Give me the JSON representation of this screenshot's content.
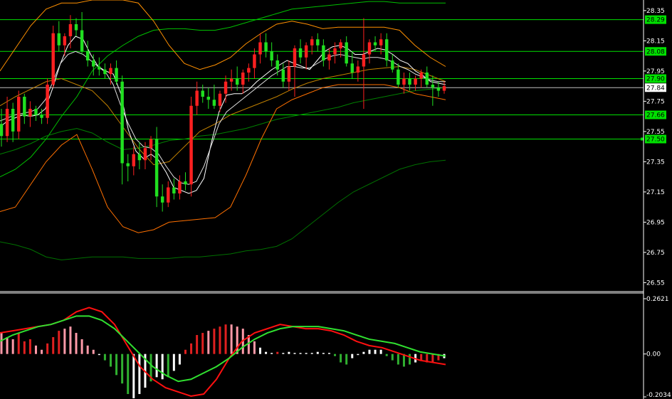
{
  "chart_data": [
    {
      "type": "candlestick",
      "panel": "price",
      "ylim": [
        26.5,
        28.42
      ],
      "y_ticks": [
        "28.35",
        "28.15",
        "27.95",
        "27.75",
        "27.55",
        "27.35",
        "27.15",
        "26.95",
        "26.75",
        "26.55"
      ],
      "y_tick_values": [
        28.35,
        28.15,
        27.95,
        27.75,
        27.55,
        27.35,
        27.15,
        26.95,
        26.75,
        26.55
      ],
      "candles": [
        [
          27.6,
          27.7,
          27.45,
          27.52
        ],
        [
          27.52,
          27.78,
          27.48,
          27.7
        ],
        [
          27.7,
          27.74,
          27.48,
          27.55
        ],
        [
          27.55,
          27.82,
          27.5,
          27.78
        ],
        [
          27.78,
          27.8,
          27.6,
          27.65
        ],
        [
          27.65,
          27.75,
          27.58,
          27.7
        ],
        [
          27.7,
          27.72,
          27.62,
          27.66
        ],
        [
          27.66,
          27.7,
          27.6,
          27.64
        ],
        [
          27.64,
          27.9,
          27.6,
          27.86
        ],
        [
          27.86,
          28.25,
          27.84,
          28.2
        ],
        [
          28.2,
          28.28,
          28.08,
          28.12
        ],
        [
          28.12,
          28.2,
          28.05,
          28.18
        ],
        [
          28.18,
          28.32,
          28.1,
          28.26
        ],
        [
          28.26,
          28.3,
          28.18,
          28.22
        ],
        [
          28.22,
          28.34,
          28.06,
          28.08
        ],
        [
          28.08,
          28.15,
          27.98,
          28.02
        ],
        [
          28.02,
          28.06,
          27.92,
          27.98
        ],
        [
          27.98,
          28.04,
          27.92,
          27.96
        ],
        [
          27.96,
          28.0,
          27.9,
          27.93
        ],
        [
          27.93,
          28.0,
          27.86,
          27.97
        ],
        [
          27.97,
          28.02,
          27.86,
          27.88
        ],
        [
          27.88,
          27.92,
          27.2,
          27.34
        ],
        [
          27.34,
          27.4,
          27.22,
          27.32
        ],
        [
          27.32,
          27.45,
          27.26,
          27.4
        ],
        [
          27.4,
          27.48,
          27.3,
          27.36
        ],
        [
          27.36,
          27.48,
          27.3,
          27.44
        ],
        [
          27.44,
          27.52,
          27.36,
          27.5
        ],
        [
          27.5,
          27.58,
          27.05,
          27.12
        ],
        [
          27.12,
          27.2,
          27.02,
          27.08
        ],
        [
          27.08,
          27.22,
          27.05,
          27.18
        ],
        [
          27.18,
          27.24,
          27.1,
          27.14
        ],
        [
          27.14,
          27.26,
          27.1,
          27.22
        ],
        [
          27.22,
          27.28,
          27.16,
          27.2
        ],
        [
          27.2,
          27.78,
          27.12,
          27.72
        ],
        [
          27.72,
          27.88,
          27.66,
          27.82
        ],
        [
          27.82,
          27.86,
          27.74,
          27.78
        ],
        [
          27.78,
          27.84,
          27.7,
          27.76
        ],
        [
          27.76,
          27.86,
          27.7,
          27.72
        ],
        [
          27.72,
          27.82,
          27.68,
          27.8
        ],
        [
          27.8,
          27.92,
          27.74,
          27.88
        ],
        [
          27.88,
          27.96,
          27.82,
          27.9
        ],
        [
          27.9,
          27.98,
          27.82,
          27.86
        ],
        [
          27.86,
          27.96,
          27.8,
          27.94
        ],
        [
          27.94,
          28.0,
          27.88,
          27.97
        ],
        [
          27.97,
          28.1,
          27.9,
          28.06
        ],
        [
          28.06,
          28.2,
          28.0,
          28.14
        ],
        [
          28.14,
          28.2,
          28.04,
          28.08
        ],
        [
          28.08,
          28.14,
          27.98,
          28.02
        ],
        [
          28.02,
          28.06,
          27.92,
          27.96
        ],
        [
          27.96,
          28.0,
          27.84,
          27.88
        ],
        [
          27.88,
          28.02,
          27.82,
          27.98
        ],
        [
          27.98,
          28.12,
          27.78,
          28.1
        ],
        [
          28.1,
          28.16,
          28.0,
          28.04
        ],
        [
          28.04,
          28.14,
          27.96,
          28.12
        ],
        [
          28.12,
          28.18,
          28.06,
          28.16
        ],
        [
          28.16,
          28.2,
          28.08,
          28.12
        ],
        [
          28.12,
          28.16,
          27.98,
          28.02
        ],
        [
          28.02,
          28.1,
          27.96,
          28.06
        ],
        [
          28.06,
          28.14,
          28.0,
          28.1
        ],
        [
          28.1,
          28.16,
          28.04,
          28.14
        ],
        [
          28.14,
          28.18,
          27.98,
          28.0
        ],
        [
          28.0,
          28.08,
          27.9,
          27.94
        ],
        [
          27.94,
          28.02,
          27.88,
          27.98
        ],
        [
          27.98,
          28.3,
          27.7,
          28.06
        ],
        [
          28.06,
          28.16,
          28.0,
          28.14
        ],
        [
          28.14,
          28.18,
          28.08,
          28.12
        ],
        [
          28.12,
          28.2,
          28.06,
          28.16
        ],
        [
          28.16,
          28.2,
          27.98,
          28.02
        ],
        [
          28.02,
          28.06,
          27.94,
          27.96
        ],
        [
          27.96,
          28.0,
          27.84,
          27.86
        ],
        [
          27.86,
          27.94,
          27.8,
          27.9
        ],
        [
          27.9,
          27.94,
          27.82,
          27.86
        ],
        [
          27.86,
          27.92,
          27.82,
          27.9
        ],
        [
          27.9,
          27.96,
          27.84,
          27.94
        ],
        [
          27.94,
          27.98,
          27.84,
          27.86
        ],
        [
          27.86,
          27.92,
          27.72,
          27.84
        ],
        [
          27.84,
          27.88,
          27.78,
          27.82
        ],
        [
          27.82,
          27.88,
          27.8,
          27.85
        ]
      ],
      "bands": [
        {
          "color": "#00c000",
          "values": [
            27.25,
            27.3,
            27.38,
            27.5,
            27.65,
            27.78,
            27.95,
            28.05,
            28.12,
            28.18,
            28.22,
            28.23,
            28.23,
            28.22,
            28.22,
            28.24,
            28.27,
            28.3,
            28.33,
            28.36,
            28.37,
            28.38,
            28.39,
            28.4,
            28.41,
            28.41,
            28.4,
            28.4,
            28.4,
            28.4
          ]
        },
        {
          "color": "#008000",
          "values": [
            27.4,
            27.43,
            27.47,
            27.52,
            27.55,
            27.57,
            27.54,
            27.48,
            27.43,
            27.44,
            27.46,
            27.49,
            27.5,
            27.52,
            27.53,
            27.55,
            27.57,
            27.6,
            27.63,
            27.65,
            27.67,
            27.69,
            27.71,
            27.74,
            27.76,
            27.78,
            27.8,
            27.82,
            27.83,
            27.84
          ]
        },
        {
          "color": "#007000",
          "values": [
            26.82,
            26.8,
            26.77,
            26.72,
            26.7,
            26.71,
            26.72,
            26.72,
            26.72,
            26.71,
            26.71,
            26.71,
            26.72,
            26.72,
            26.73,
            26.74,
            26.76,
            26.77,
            26.79,
            26.84,
            26.92,
            27.0,
            27.08,
            27.15,
            27.2,
            27.25,
            27.3,
            27.33,
            27.35,
            27.36
          ]
        },
        {
          "color": "#ff9000",
          "values": [
            27.95,
            28.1,
            28.25,
            28.36,
            28.4,
            28.4,
            28.42,
            28.42,
            28.42,
            28.4,
            28.28,
            28.12,
            28.0,
            27.96,
            27.99,
            28.04,
            28.13,
            28.2,
            28.26,
            28.28,
            28.26,
            28.23,
            28.24,
            28.24,
            28.24,
            28.24,
            28.22,
            28.12,
            28.04,
            27.98
          ]
        },
        {
          "color": "#c08000",
          "values": [
            27.72,
            27.78,
            27.83,
            27.88,
            27.9,
            27.86,
            27.82,
            27.72,
            27.58,
            27.44,
            27.33,
            27.35,
            27.45,
            27.55,
            27.6,
            27.66,
            27.7,
            27.74,
            27.78,
            27.83,
            27.87,
            27.9,
            27.92,
            27.94,
            27.96,
            27.97,
            27.98,
            27.96,
            27.92,
            27.88
          ]
        },
        {
          "color": "#ff7000",
          "values": [
            27.02,
            27.05,
            27.2,
            27.35,
            27.46,
            27.53,
            27.3,
            27.05,
            26.92,
            26.88,
            26.9,
            26.95,
            26.96,
            26.97,
            26.98,
            27.05,
            27.26,
            27.5,
            27.7,
            27.76,
            27.8,
            27.84,
            27.86,
            27.86,
            27.86,
            27.86,
            27.84,
            27.8,
            27.78,
            27.76
          ]
        }
      ],
      "moving_averages": [
        {
          "color": "#ffffff",
          "values": [
            27.58,
            27.62,
            27.64,
            27.66,
            27.65,
            27.66,
            27.7,
            27.84,
            28.0,
            28.12,
            28.18,
            28.16,
            28.06,
            27.98,
            27.95,
            27.93,
            27.8,
            27.56,
            27.42,
            27.37,
            27.4,
            27.36,
            27.28,
            27.18,
            27.16,
            27.14,
            27.16,
            27.24,
            27.48,
            27.68,
            27.79,
            27.8,
            27.8,
            27.83,
            27.88,
            27.92,
            27.96,
            27.99,
            28.02,
            28.0,
            27.98,
            27.96,
            28.02,
            28.08,
            28.11,
            28.12,
            28.1,
            28.06,
            28.06,
            28.08,
            28.1,
            28.09,
            28.06,
            28.02,
            28.0,
            27.95,
            27.92,
            27.88,
            27.87,
            27.86
          ]
        },
        {
          "color": "#e0e0e0",
          "values": [
            27.62,
            27.64,
            27.66,
            27.67,
            27.68,
            27.7,
            27.76,
            27.88,
            28.0,
            28.06,
            28.08,
            28.06,
            28.02,
            27.98,
            27.94,
            27.86,
            27.72,
            27.6,
            27.5,
            27.45,
            27.44,
            27.4,
            27.32,
            27.25,
            27.21,
            27.2,
            27.22,
            27.32,
            27.46,
            27.6,
            27.68,
            27.72,
            27.76,
            27.8,
            27.84,
            27.88,
            27.92,
            27.95,
            27.98,
            27.98,
            27.97,
            27.97,
            28.0,
            28.03,
            28.05,
            28.06,
            28.05,
            28.04,
            28.03,
            28.04,
            28.04,
            28.03,
            28.01,
            27.98,
            27.96,
            27.93,
            27.91,
            27.89,
            27.88,
            27.88
          ]
        }
      ],
      "h_levels": [
        28.29,
        28.08,
        27.9,
        27.66,
        27.5
      ],
      "h_level_labels": [
        "28.29",
        "28.08",
        "27.90",
        "27.66",
        "27.50"
      ],
      "current_price": 27.84,
      "current_price_label": "27.84"
    },
    {
      "type": "histogram+line",
      "panel": "oscillator",
      "ylim": [
        -0.2034,
        0.2621
      ],
      "y_ticks": [
        "0.2621",
        "0.00",
        "-0.2034"
      ],
      "y_tick_values": [
        0.2621,
        0.0,
        -0.2034
      ],
      "histogram": [
        0.1,
        0.08,
        0.07,
        0.1,
        0.06,
        0.07,
        0.04,
        0.02,
        0.05,
        0.08,
        0.11,
        0.12,
        0.13,
        0.1,
        0.07,
        0.04,
        0.02,
        -0.005,
        -0.03,
        -0.06,
        -0.1,
        -0.14,
        -0.19,
        -0.21,
        -0.19,
        -0.16,
        -0.13,
        -0.11,
        -0.12,
        -0.11,
        -0.08,
        -0.05,
        0.02,
        0.05,
        0.09,
        0.1,
        0.11,
        0.12,
        0.13,
        0.14,
        0.14,
        0.13,
        0.12,
        0.09,
        0.06,
        0.03,
        0.01,
        0.005,
        0.01,
        0.005,
        0.01,
        0.005,
        0.005,
        0.005,
        0.005,
        0.01,
        0.005,
        0.005,
        -0.01,
        -0.04,
        -0.05,
        -0.02,
        -0.005,
        0.01,
        0.02,
        0.02,
        0.02,
        -0.01,
        -0.03,
        -0.05,
        -0.06,
        -0.05,
        -0.04,
        -0.03,
        -0.04,
        -0.04,
        -0.03,
        -0.02
      ],
      "histogram_colors": [
        "#ff9aa8",
        "#ff9aa8",
        "#ff9aa8",
        "#e02020",
        "#e02020",
        "#e02020",
        "#ff9aa8",
        "#ff9aa8",
        "#e02020",
        "#e02020",
        "#e02020",
        "#ff9aa8",
        "#ff9aa8",
        "#ff9aa8",
        "#ff9aa8",
        "#ff9aa8",
        "#ff9aa8",
        "#ffffff",
        "#30b030",
        "#30b030",
        "#30b030",
        "#30b030",
        "#30b030",
        "#ffffff",
        "#ffffff",
        "#ffffff",
        "#30b030",
        "#ffffff",
        "#ffffff",
        "#30b030",
        "#ffffff",
        "#ffffff",
        "#e02020",
        "#e02020",
        "#e02020",
        "#e02020",
        "#ff9aa8",
        "#e02020",
        "#e02020",
        "#e02020",
        "#ff9aa8",
        "#ff9aa8",
        "#ff9aa8",
        "#ff9aa8",
        "#ff9aa8",
        "#ffffff",
        "#ffffff",
        "#ffffff",
        "#e02020",
        "#ffffff",
        "#ffffff",
        "#ffffff",
        "#ffffff",
        "#ffffff",
        "#ffffff",
        "#ffffff",
        "#ffffff",
        "#ffffff",
        "#30b030",
        "#30b030",
        "#30b030",
        "#ffffff",
        "#ffffff",
        "#ffffff",
        "#ffffff",
        "#ffffff",
        "#ffffff",
        "#30b030",
        "#30b030",
        "#30b030",
        "#30b030",
        "#30b030",
        "#ffffff",
        "#e02020",
        "#e02020",
        "#e02020",
        "#e02020",
        "#ffffff"
      ],
      "signal_line": {
        "color": "#ff1010",
        "values": [
          0.1,
          0.11,
          0.12,
          0.13,
          0.14,
          0.16,
          0.2,
          0.22,
          0.2,
          0.14,
          0.04,
          -0.06,
          -0.12,
          -0.16,
          -0.18,
          -0.2,
          -0.19,
          -0.12,
          -0.02,
          0.06,
          0.1,
          0.12,
          0.14,
          0.13,
          0.12,
          0.12,
          0.11,
          0.09,
          0.06,
          0.04,
          0.03,
          0.01,
          -0.01,
          -0.03,
          -0.04,
          -0.05
        ]
      },
      "main_line": {
        "color": "#30e030",
        "values": [
          0.06,
          0.09,
          0.11,
          0.13,
          0.14,
          0.16,
          0.18,
          0.18,
          0.16,
          0.12,
          0.06,
          0.0,
          -0.06,
          -0.1,
          -0.13,
          -0.12,
          -0.09,
          -0.06,
          -0.02,
          0.03,
          0.07,
          0.1,
          0.12,
          0.13,
          0.13,
          0.13,
          0.12,
          0.11,
          0.09,
          0.07,
          0.06,
          0.05,
          0.03,
          0.01,
          0.0,
          -0.01
        ]
      }
    }
  ]
}
